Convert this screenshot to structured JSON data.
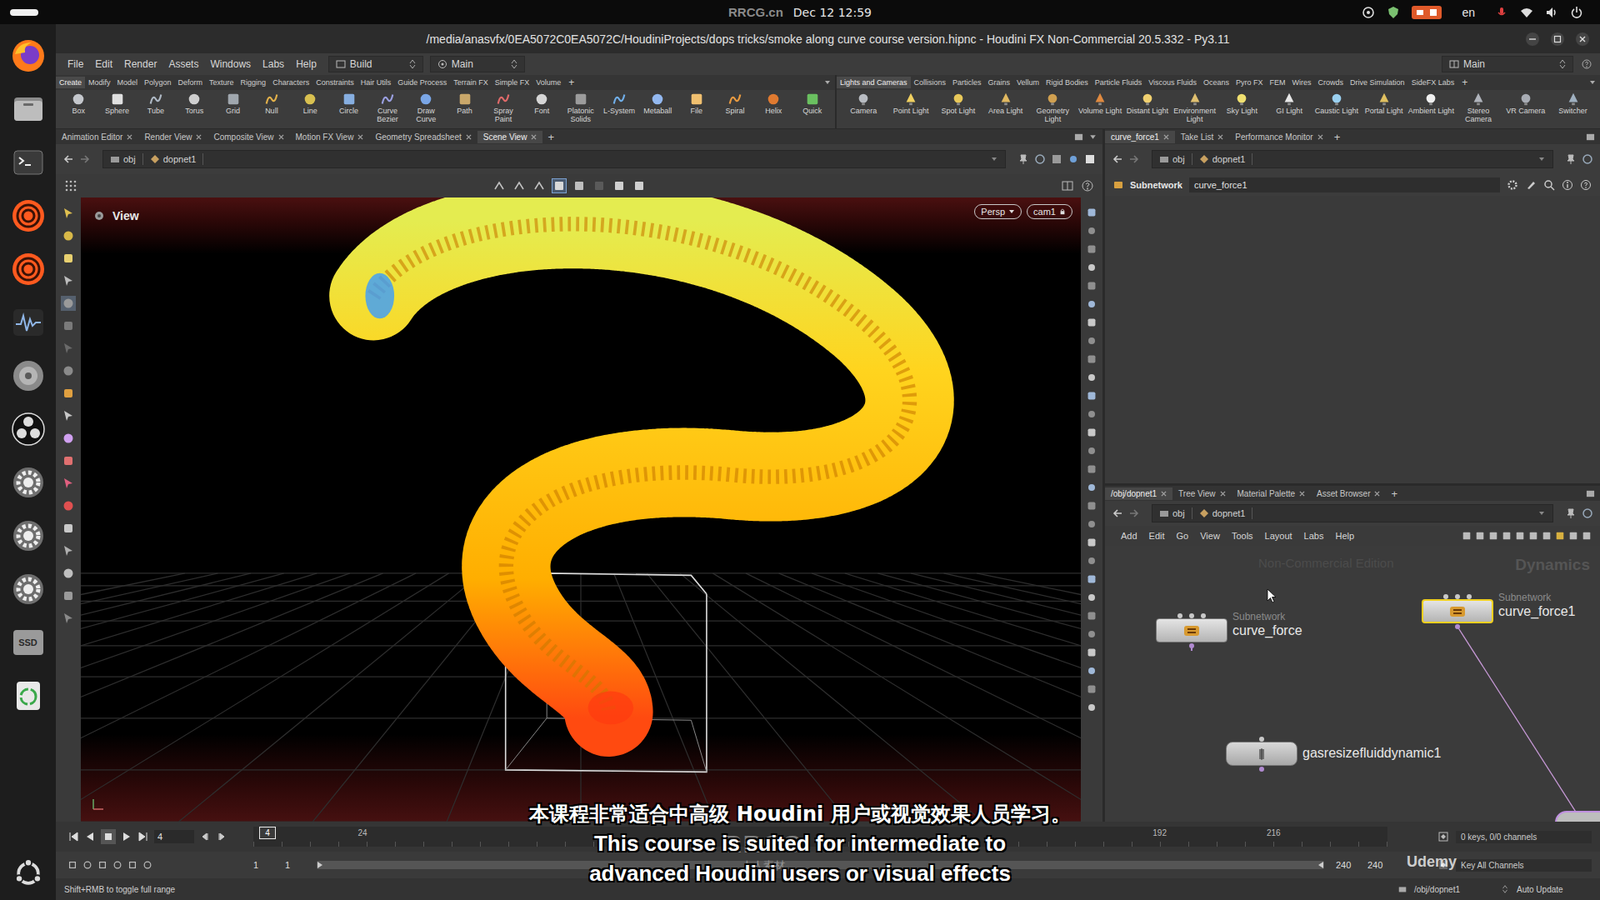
{
  "system_bar": {
    "clock": "Dec 12 12:59",
    "language": "en",
    "watermark": "RRCG.cn"
  },
  "dock": {
    "drive_label": "SSD"
  },
  "window": {
    "title": "/media/anasvfx/0EA5072C0EA5072C/HoudiniProjects/dops tricks/smoke along curve course version.hipnc - Houdini FX Non-Commercial 20.5.332 - Py3.11"
  },
  "menu_bar": {
    "items": [
      "File",
      "Edit",
      "Render",
      "Assets",
      "Windows",
      "Labs",
      "Help"
    ],
    "desktop": "Build",
    "main": "Main",
    "right_main": "Main"
  },
  "shelf_left": {
    "tabs": [
      {
        "label": "Create",
        "selected": true
      },
      {
        "label": "Modify",
        "selected": false
      },
      {
        "label": "Model",
        "selected": false
      },
      {
        "label": "Polygon",
        "selected": false
      },
      {
        "label": "Deform",
        "selected": false
      },
      {
        "label": "Texture",
        "selected": false
      },
      {
        "label": "Rigging",
        "selected": false
      },
      {
        "label": "Characters",
        "selected": false
      },
      {
        "label": "Constraints",
        "selected": false
      },
      {
        "label": "Hair Utils",
        "selected": false
      },
      {
        "label": "Guide Process",
        "selected": false
      },
      {
        "label": "Terrain FX",
        "selected": false
      },
      {
        "label": "Simple FX",
        "selected": false
      },
      {
        "label": "Volume",
        "selected": false
      }
    ],
    "add": "+",
    "tools": [
      "Box",
      "Sphere",
      "Tube",
      "Torus",
      "Grid",
      "Null",
      "Line",
      "Circle",
      "Curve Bezier",
      "Draw Curve",
      "Path",
      "Spray Paint",
      "Font",
      "Platonic Solids",
      "L-System",
      "Metaball",
      "File",
      "Spiral",
      "Helix",
      "Quick"
    ]
  },
  "shelf_right": {
    "tabs": [
      {
        "label": "Lights and Cameras",
        "selected": true
      },
      {
        "label": "Collisions",
        "selected": false
      },
      {
        "label": "Particles",
        "selected": false
      },
      {
        "label": "Grains",
        "selected": false
      },
      {
        "label": "Vellum",
        "selected": false
      },
      {
        "label": "Rigid Bodies",
        "selected": false
      },
      {
        "label": "Particle Fluids",
        "selected": false
      },
      {
        "label": "Viscous Fluids",
        "selected": false
      },
      {
        "label": "Oceans",
        "selected": false
      },
      {
        "label": "Pyro FX",
        "selected": false
      },
      {
        "label": "FEM",
        "selected": false
      },
      {
        "label": "Wires",
        "selected": false
      },
      {
        "label": "Crowds",
        "selected": false
      },
      {
        "label": "Drive Simulation",
        "selected": false
      },
      {
        "label": "SideFX Labs",
        "selected": false
      }
    ],
    "add": "+",
    "tools": [
      "Camera",
      "Point Light",
      "Spot Light",
      "Area Light",
      "Geometry Light",
      "Volume Light",
      "Distant Light",
      "Environment Light",
      "Sky Light",
      "GI Light",
      "Caustic Light",
      "Portal Light",
      "Ambient Light",
      "Stereo Camera",
      "VR Camera",
      "Switcher"
    ]
  },
  "scene_pane": {
    "tabs": [
      {
        "label": "Animation Editor",
        "selected": false
      },
      {
        "label": "Render View",
        "selected": false
      },
      {
        "label": "Composite View",
        "selected": false
      },
      {
        "label": "Motion FX View",
        "selected": false
      },
      {
        "label": "Geometry Spreadsheet",
        "selected": false
      },
      {
        "label": "Scene View",
        "selected": true
      }
    ],
    "add": "+",
    "path": [
      "obj",
      "dopnet1"
    ],
    "viewport": {
      "label": "View",
      "projection": "Persp",
      "camera": "cam1"
    }
  },
  "parameter_pane": {
    "tabs": [
      {
        "label": "curve_force1",
        "selected": true
      },
      {
        "label": "Take List",
        "selected": false
      },
      {
        "label": "Performance Monitor",
        "selected": false
      }
    ],
    "add": "+",
    "path": [
      "obj",
      "dopnet1"
    ],
    "node_type": "Subnetwork",
    "node_name": "curve_force1"
  },
  "network_pane": {
    "tabs": [
      {
        "label": "/obj/dopnet1",
        "selected": true
      },
      {
        "label": "Tree View",
        "selected": false
      },
      {
        "label": "Material Palette",
        "selected": false
      },
      {
        "label": "Asset Browser",
        "selected": false
      }
    ],
    "add": "+",
    "path": [
      "obj",
      "dopnet1"
    ],
    "menu": [
      "Add",
      "Edit",
      "Go",
      "View",
      "Tools",
      "Layout",
      "Labs",
      "Help"
    ],
    "edition": "Non-Commercial Edition",
    "context": "Dynamics",
    "nodes": [
      {
        "kind": "subnet",
        "type": "Subnetwork",
        "name": "curve_force",
        "selected": false
      },
      {
        "kind": "subnet",
        "type": "Subnetwork",
        "name": "curve_force1",
        "selected": true
      },
      {
        "kind": "solver",
        "name": "gasresizefluiddynamic1",
        "selected": false
      }
    ]
  },
  "timeline": {
    "frame": "4",
    "marker": "4",
    "ticks": [
      "24",
      "192",
      "216"
    ],
    "range_start": "1",
    "playback_start": "1",
    "playback_end": "240",
    "range_end": "240",
    "keys": "0 keys, 0/0 channels",
    "key_all": "Key All Channels"
  },
  "status_bar": {
    "hint": "Shift+RMB to toggle full range",
    "path": "/obj/dopnet1",
    "update": "Auto Update"
  },
  "subtitles": {
    "chinese": "本课程非常适合中高级 Houdini 用户或视觉效果人员学习。",
    "english": [
      "This course is suited for intermediate to",
      "advanced Houdini users or visual effects"
    ]
  },
  "watermarks": {
    "logo": "RRCG",
    "logo_sub": "人人素材",
    "platform": "Udemy"
  }
}
